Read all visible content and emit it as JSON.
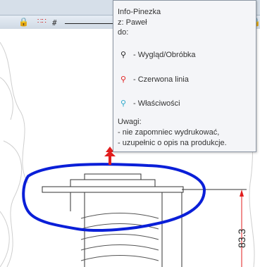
{
  "tooltip": {
    "title": "Info-Pinezka",
    "author": "z: Paweł",
    "to_label": "do:",
    "items": [
      {
        "label": "- Wygląd/Obróbka",
        "icon": "pin-list-icon"
      },
      {
        "label": "- Czerwona linia",
        "icon": "pin-redline-icon"
      },
      {
        "label": "- Właściwości",
        "icon": "pin-properties-icon"
      }
    ],
    "notes_title": "Uwagi:",
    "notes": [
      "- nie zapomniec wydrukować,",
      "- uzupełnic o opis na produkcje."
    ]
  },
  "dimension": "83.3",
  "colors": {
    "markup": "#0a1fd8",
    "dimension": "#e11d1d",
    "pin": "#e11d1d"
  }
}
